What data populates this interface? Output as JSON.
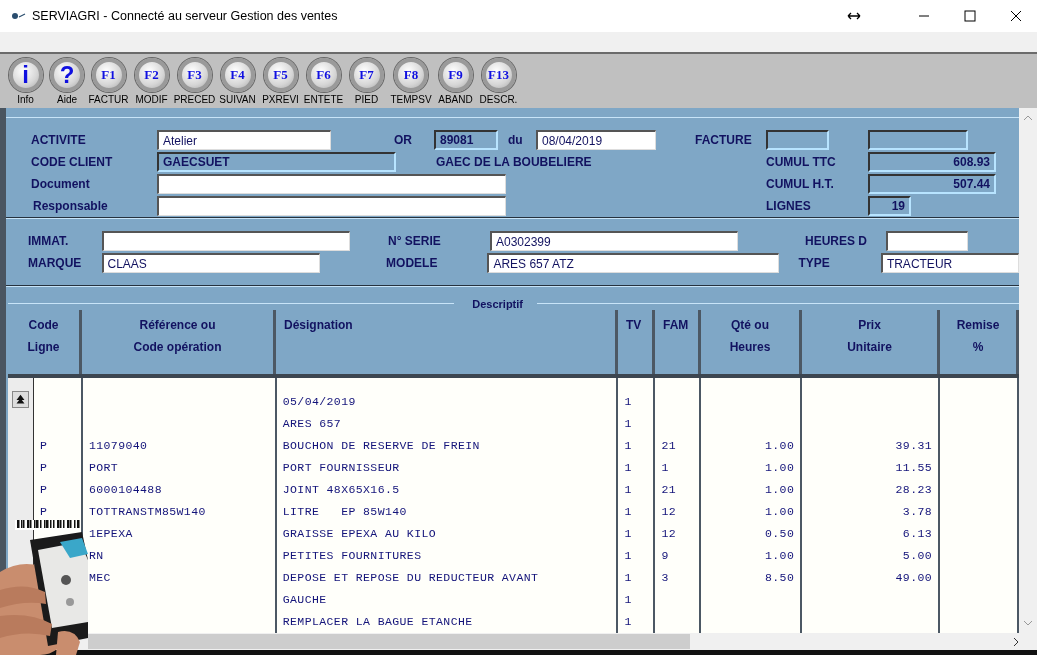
{
  "window": {
    "title": "SERVIAGRI - Connecté au serveur Gestion des ventes"
  },
  "toolbar": [
    {
      "kind": "symbol",
      "key": "i",
      "label": "Info"
    },
    {
      "kind": "symbol",
      "key": "?",
      "label": "Aide"
    },
    {
      "kind": "fkey",
      "key": "F1",
      "label": "FACTUR"
    },
    {
      "kind": "fkey",
      "key": "F2",
      "label": "MODIF"
    },
    {
      "kind": "fkey",
      "key": "F3",
      "label": "PRECED"
    },
    {
      "kind": "fkey",
      "key": "F4",
      "label": "SUIVAN"
    },
    {
      "kind": "fkey",
      "key": "F5",
      "label": "PXREVI"
    },
    {
      "kind": "fkey",
      "key": "F6",
      "label": "ENTETE"
    },
    {
      "kind": "fkey",
      "key": "F7",
      "label": "PIED"
    },
    {
      "kind": "fkey",
      "key": "F8",
      "label": "TEMPSV"
    },
    {
      "kind": "fkey",
      "key": "F9",
      "label": "ABAND"
    },
    {
      "kind": "fkey",
      "key": "F13",
      "label": "DESCR."
    }
  ],
  "header": [
    [
      {
        "kind": "label",
        "text": "ACTIVITE"
      },
      {
        "kind": "field",
        "value": "Atelier",
        "readonly": false
      },
      {
        "kind": "label",
        "text": "OR"
      },
      {
        "kind": "field",
        "value": "89081",
        "readonly": true
      },
      {
        "kind": "label",
        "text": "du"
      },
      {
        "kind": "field",
        "value": "08/04/2019",
        "readonly": false
      },
      {
        "kind": "label",
        "text": "FACTURE"
      },
      {
        "kind": "field",
        "readonly": true
      },
      {
        "kind": "field",
        "readonly": true
      }
    ],
    [
      {
        "kind": "label",
        "text": "CODE CLIENT"
      },
      {
        "kind": "field",
        "value": "GAECSUET",
        "readonly": true
      },
      {
        "kind": "label",
        "text": "GAEC DE LA BOUBELIERE"
      },
      {
        "kind": "label",
        "text": "CUMUL TTC"
      },
      {
        "kind": "field",
        "value": "608.93",
        "readonly": true
      }
    ],
    [
      {
        "kind": "label",
        "text": "Document"
      },
      {
        "kind": "field",
        "readonly": false
      },
      {
        "kind": "label",
        "text": "CUMUL H.T."
      },
      {
        "kind": "field",
        "value": "507.44",
        "readonly": true
      }
    ],
    [
      {
        "kind": "label",
        "text": "Responsable"
      },
      {
        "kind": "field",
        "readonly": false
      },
      {
        "kind": "label",
        "text": "LIGNES"
      },
      {
        "kind": "field",
        "value": "19",
        "readonly": true
      }
    ]
  ],
  "machine": [
    [
      {
        "kind": "label",
        "text": "IMMAT."
      },
      {
        "kind": "field",
        "readonly": false
      },
      {
        "kind": "label",
        "text": "N° SERIE"
      },
      {
        "kind": "field",
        "value": "A0302399",
        "readonly": false
      },
      {
        "kind": "label",
        "text": "HEURES D"
      },
      {
        "kind": "field",
        "readonly": false
      }
    ],
    [
      {
        "kind": "label",
        "text": "MARQUE"
      },
      {
        "kind": "field",
        "value": "CLAAS",
        "readonly": false
      },
      {
        "kind": "label",
        "text": "MODELE"
      },
      {
        "kind": "field",
        "value": "ARES 657 ATZ",
        "readonly": false
      },
      {
        "kind": "label",
        "text": "TYPE"
      },
      {
        "kind": "field",
        "value": "TRACTEUR",
        "readonly": false
      }
    ]
  ],
  "table": {
    "title": "Descriptif",
    "columns": [
      "Code\nLigne",
      "Référence ou\nCode opération",
      "Désignation",
      "TV",
      "FAM",
      "Qté ou\nHeures",
      "Prix\nUnitaire",
      "Remise\n%"
    ],
    "rows": [
      {
        "designation": "05/04/2019",
        "tv": "1"
      },
      {
        "designation": "ARES 657",
        "tv": "1"
      },
      {
        "code": "P",
        "reference": "11079040",
        "designation": "BOUCHON DE RESERVE DE FREIN",
        "tv": "1",
        "fam": "21",
        "qty": "1.00",
        "price": "39.31"
      },
      {
        "code": "P",
        "reference": "PORT",
        "designation": "PORT FOURNISSEUR",
        "tv": "1",
        "fam": "1",
        "qty": "1.00",
        "price": "11.55"
      },
      {
        "code": "P",
        "reference": "6000104488",
        "designation": "JOINT 48X65X16.5",
        "tv": "1",
        "fam": "21",
        "qty": "1.00",
        "price": "28.23"
      },
      {
        "code": "P",
        "reference": "TOTTRANSTM85W140",
        "designation": "LITRE   EP 85W140",
        "tv": "1",
        "fam": "12",
        "qty": "1.00",
        "price": "3.78"
      },
      {
        "reference": "1EPEXA",
        "designation": "GRAISSE EPEXA AU KILO",
        "tv": "1",
        "fam": "12",
        "qty": "0.50",
        "price": "6.13"
      },
      {
        "reference": "RN",
        "designation": "PETITES FOURNITURES",
        "tv": "1",
        "fam": "9",
        "qty": "1.00",
        "price": "5.00"
      },
      {
        "reference": "MEC",
        "designation": "DEPOSE ET REPOSE DU REDUCTEUR AVANT",
        "tv": "1",
        "fam": "3",
        "qty": "8.50",
        "price": "49.00"
      },
      {
        "designation": "GAUCHE",
        "tv": "1"
      },
      {
        "designation": "REMPLACER LA BAGUE ETANCHE",
        "tv": "1"
      }
    ]
  },
  "overlay": {
    "kind": "picture"
  }
}
